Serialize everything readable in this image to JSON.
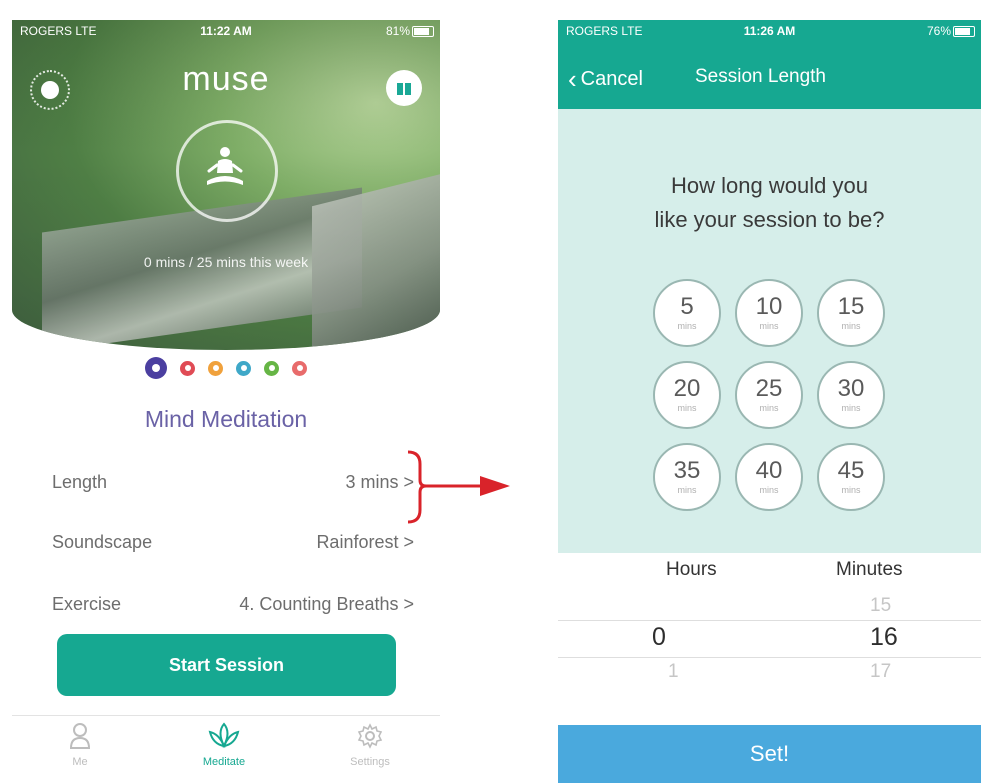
{
  "left_screen": {
    "status": {
      "carrier": "ROGERS LTE",
      "time": "11:22 AM",
      "battery": "81%"
    },
    "brand": "muse",
    "progress_text": "0 mins / 25 mins this week",
    "category_dot_colors": [
      "#4b3fa0",
      "#e04b55",
      "#f0a13c",
      "#3fa8c8",
      "#66b545",
      "#e86b6b"
    ],
    "title": "Mind Meditation",
    "settings": [
      {
        "label": "Length",
        "value": "3 mins >"
      },
      {
        "label": "Soundscape",
        "value": "Rainforest >"
      },
      {
        "label": "Exercise",
        "value": "4. Counting Breaths >"
      }
    ],
    "start_button": "Start Session",
    "tabs": [
      {
        "label": "Me",
        "icon": "person-icon"
      },
      {
        "label": "Meditate",
        "icon": "lotus-icon"
      },
      {
        "label": "Settings",
        "icon": "gear-icon"
      }
    ]
  },
  "annotation": {
    "arrow_color": "#d9232a"
  },
  "right_screen": {
    "status": {
      "carrier": "ROGERS LTE",
      "time": "11:26 AM",
      "battery": "76%"
    },
    "cancel_label": "Cancel",
    "header_title": "Session Length",
    "question_line1": "How long would you",
    "question_line2": "like your session to be?",
    "options": [
      {
        "value": "5",
        "unit": "mins"
      },
      {
        "value": "10",
        "unit": "mins"
      },
      {
        "value": "15",
        "unit": "mins"
      },
      {
        "value": "20",
        "unit": "mins"
      },
      {
        "value": "25",
        "unit": "mins"
      },
      {
        "value": "30",
        "unit": "mins"
      },
      {
        "value": "35",
        "unit": "mins"
      },
      {
        "value": "40",
        "unit": "mins"
      },
      {
        "value": "45",
        "unit": "mins"
      }
    ],
    "picker": {
      "hours_label": "Hours",
      "minutes_label": "Minutes",
      "hours": {
        "selected": "0",
        "next": "1"
      },
      "minutes": {
        "previous": "15",
        "selected": "16",
        "next": "17"
      }
    },
    "set_button": "Set!",
    "colors": {
      "teal": "#16a891",
      "light_teal": "#d6eeea",
      "set_blue": "#4aa9dd"
    }
  }
}
